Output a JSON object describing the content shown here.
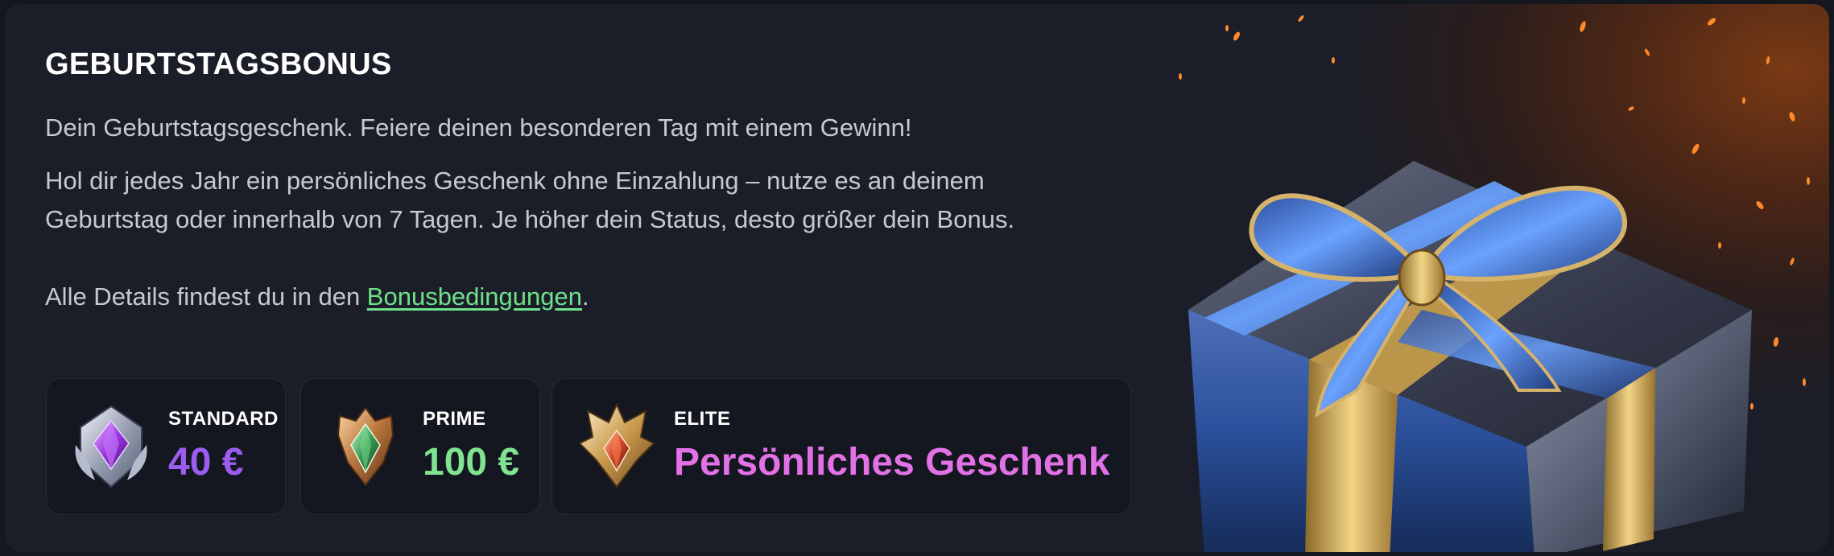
{
  "banner": {
    "title": "GEBURTSTAGSBONUS",
    "intro": "Dein Geburtstagsgeschenk. Feiere deinen besonderen Tag mit einem Gewinn!",
    "line1": "Hol dir jedes Jahr ein persönliches Geschenk ohne Einzahlung – nutze es an deinem",
    "line2": "Geburtstag oder innerhalb von 7 Tagen. Je höher dein Status, desto größer dein Bonus.",
    "details_prefix": "Alle Details findest du in den ",
    "details_link": "Bonusbedingungen",
    "details_suffix": "."
  },
  "tiers": [
    {
      "name": "STANDARD",
      "value": "40 €",
      "icon": "silver-purple-gem-badge-icon",
      "color": "#9b5cf0"
    },
    {
      "name": "PRIME",
      "value": "100 €",
      "icon": "bronze-green-gem-badge-icon",
      "color": "#7fe38f"
    },
    {
      "name": "ELITE",
      "value": "Persönliches Geschenk",
      "icon": "gold-red-gem-crown-badge-icon",
      "color": "#e271e6"
    }
  ],
  "illustration": {
    "icon": "gift-box-icon",
    "accent": "#c68a2a"
  }
}
